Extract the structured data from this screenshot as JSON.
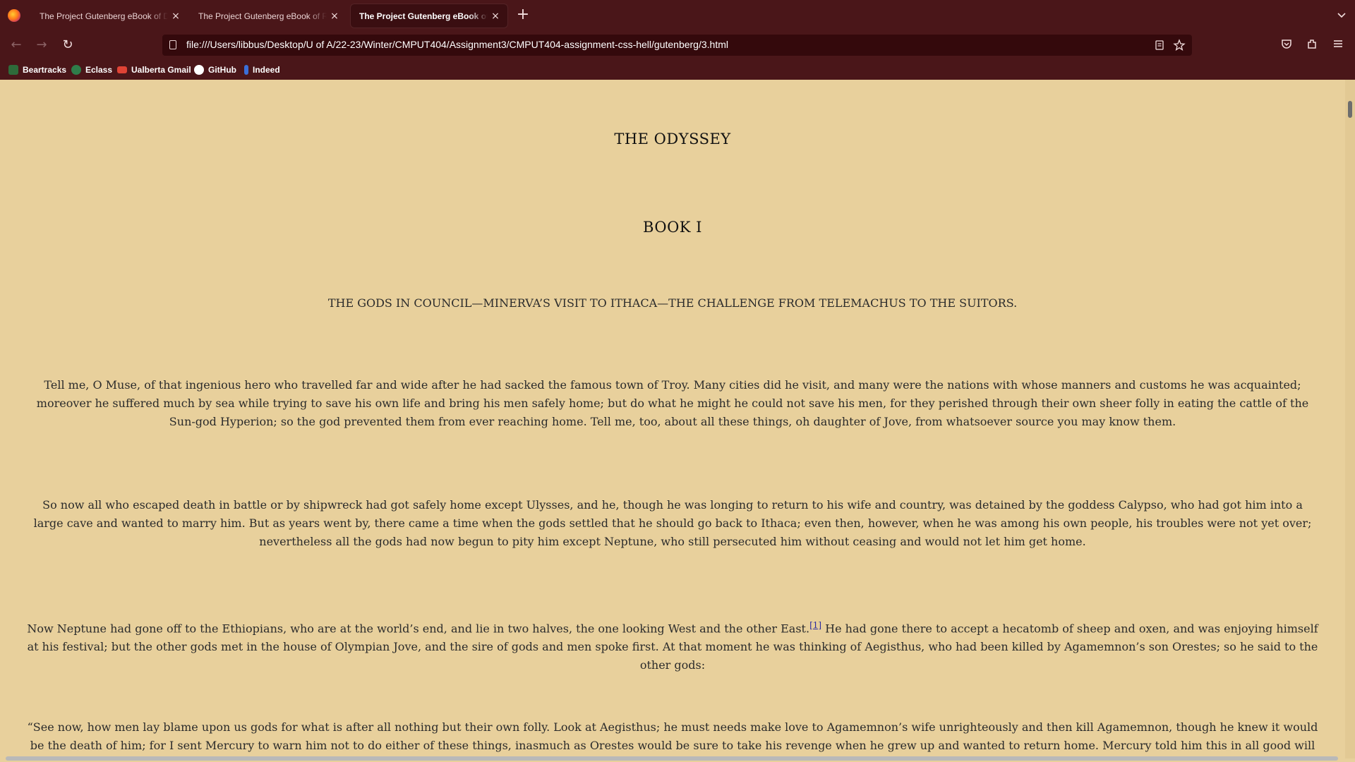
{
  "browser": {
    "tabs": [
      {
        "title": "The Project Gutenberg eBook of Dracula",
        "active": false
      },
      {
        "title": "The Project Gutenberg eBook of Romeo and Juliet",
        "active": false
      },
      {
        "title": "The Project Gutenberg eBook of The Odyssey",
        "active": true
      }
    ],
    "close_glyph": "×",
    "new_tab_glyph": "+",
    "url": "file:///Users/libbus/Desktop/U of A/22-23/Winter/CMPUT404/Assignment3/CMPUT404-assignment-css-hell/gutenberg/3.html",
    "bookmarks": [
      {
        "label": "Beartracks",
        "icon": "beartracks-icon",
        "color": "#2e6b3a"
      },
      {
        "label": "Eclass",
        "icon": "eclass-icon",
        "color": "#2f7d4a"
      },
      {
        "label": "Ualberta Gmail",
        "icon": "gmail-icon",
        "color": "#e04335"
      },
      {
        "label": "GitHub",
        "icon": "github-icon",
        "color": "#ffffff"
      },
      {
        "label": "Indeed",
        "icon": "indeed-icon",
        "color": "#3a6fd8"
      }
    ],
    "colors": {
      "chrome": "#4a1619",
      "urlbar": "#34090c",
      "page_bg": "#e8d09c"
    }
  },
  "page": {
    "title": "THE ODYSSEY",
    "book": "BOOK I",
    "subtitle": "THE GODS IN COUNCIL—MINERVA’S VISIT TO ITHACA—THE CHALLENGE FROM TELEMACHUS TO THE SUITORS.",
    "p1": "Tell me, O Muse, of that ingenious hero who travelled far and wide after he had sacked the famous town of Troy. Many cities did he visit, and many were the nations with whose manners and customs he was acquainted; moreover he suffered much by sea while trying to save his own life and bring his men safely home; but do what he might he could not save his men, for they perished through their own sheer folly in eating the cattle of the Sun-god Hyperion; so the god prevented them from ever reaching home. Tell me, too, about all these things, oh daughter of Jove, from whatsoever source you may know them.",
    "p2": "So now all who escaped death in battle or by shipwreck had got safely home except Ulysses, and he, though he was longing to return to his wife and country, was detained by the goddess Calypso, who had got him into a large cave and wanted to marry him. But as years went by, there came a time when the gods settled that he should go back to Ithaca; even then, however, when he was among his own people, his troubles were not yet over; nevertheless all the gods had now begun to pity him except Neptune, who still persecuted him without ceasing and would not let him get home.",
    "p3_before": "Now Neptune had gone off to the Ethiopians, who are at the world’s end, and lie in two halves, the one looking West and the other East.",
    "p3_footnote": "[1]",
    "p3_after": " He had gone there to accept a hecatomb of sheep and oxen, and was enjoying himself at his festival; but the other gods met in the house of Olympian Jove, and the sire of gods and men spoke first. At that moment he was thinking of Aegisthus, who had been killed by Agamemnon’s son Orestes; so he said to the other gods:",
    "p4": "“See now, how men lay blame upon us gods for what is after all nothing but their own folly. Look at Aegisthus; he must needs make love to Agamemnon’s wife unrighteously and then kill Agamemnon, though he knew it would be the death of him; for I sent Mercury to warn him not to do either of these things, inasmuch as Orestes would be sure to take his revenge when he grew up and wanted to return home. Mercury told him this in all good will but he would not listen, and now he has paid for everything in full.”"
  }
}
